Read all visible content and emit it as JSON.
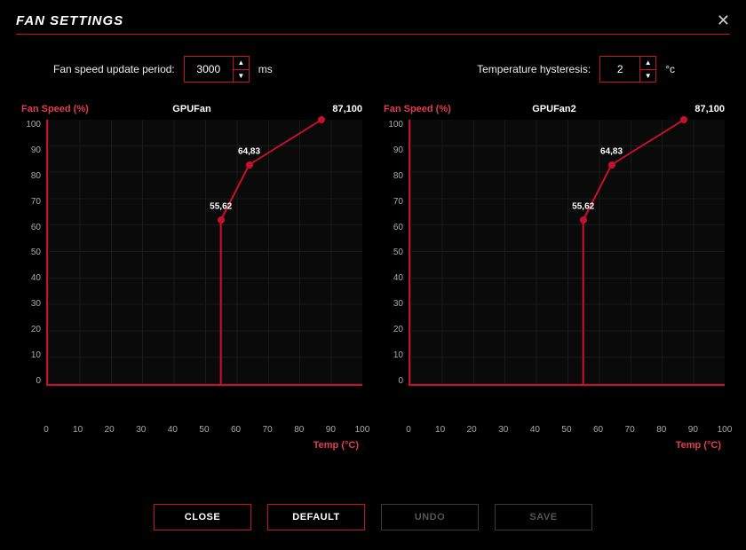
{
  "title": "FAN SETTINGS",
  "controls": {
    "update_label": "Fan speed update period:",
    "update_value": "3000",
    "update_unit": "ms",
    "hysteresis_label": "Temperature hysteresis:",
    "hysteresis_value": "2",
    "hysteresis_unit": "°c"
  },
  "buttons": {
    "close": "CLOSE",
    "default": "DEFAULT",
    "undo": "UNDO",
    "save": "SAVE"
  },
  "chart_data": [
    {
      "type": "line",
      "title": "GPUFan",
      "ylabel": "Fan Speed (%)",
      "xlabel": "Temp (°C)",
      "xlim": [
        0,
        100
      ],
      "ylim": [
        0,
        100
      ],
      "xticks": [
        0,
        10,
        20,
        30,
        40,
        50,
        60,
        70,
        80,
        90,
        100
      ],
      "yticks": [
        0,
        10,
        20,
        30,
        40,
        50,
        60,
        70,
        80,
        90,
        100
      ],
      "points": [
        {
          "x": 55,
          "y": 62,
          "label": "55,62"
        },
        {
          "x": 64,
          "y": 83,
          "label": "64,83"
        },
        {
          "x": 87,
          "y": 100,
          "label": "87,100"
        }
      ]
    },
    {
      "type": "line",
      "title": "GPUFan2",
      "ylabel": "Fan Speed (%)",
      "xlabel": "Temp (°C)",
      "xlim": [
        0,
        100
      ],
      "ylim": [
        0,
        100
      ],
      "xticks": [
        0,
        10,
        20,
        30,
        40,
        50,
        60,
        70,
        80,
        90,
        100
      ],
      "yticks": [
        0,
        10,
        20,
        30,
        40,
        50,
        60,
        70,
        80,
        90,
        100
      ],
      "points": [
        {
          "x": 55,
          "y": 62,
          "label": "55,62"
        },
        {
          "x": 64,
          "y": 83,
          "label": "64,83"
        },
        {
          "x": 87,
          "y": 100,
          "label": "87,100"
        }
      ]
    }
  ]
}
